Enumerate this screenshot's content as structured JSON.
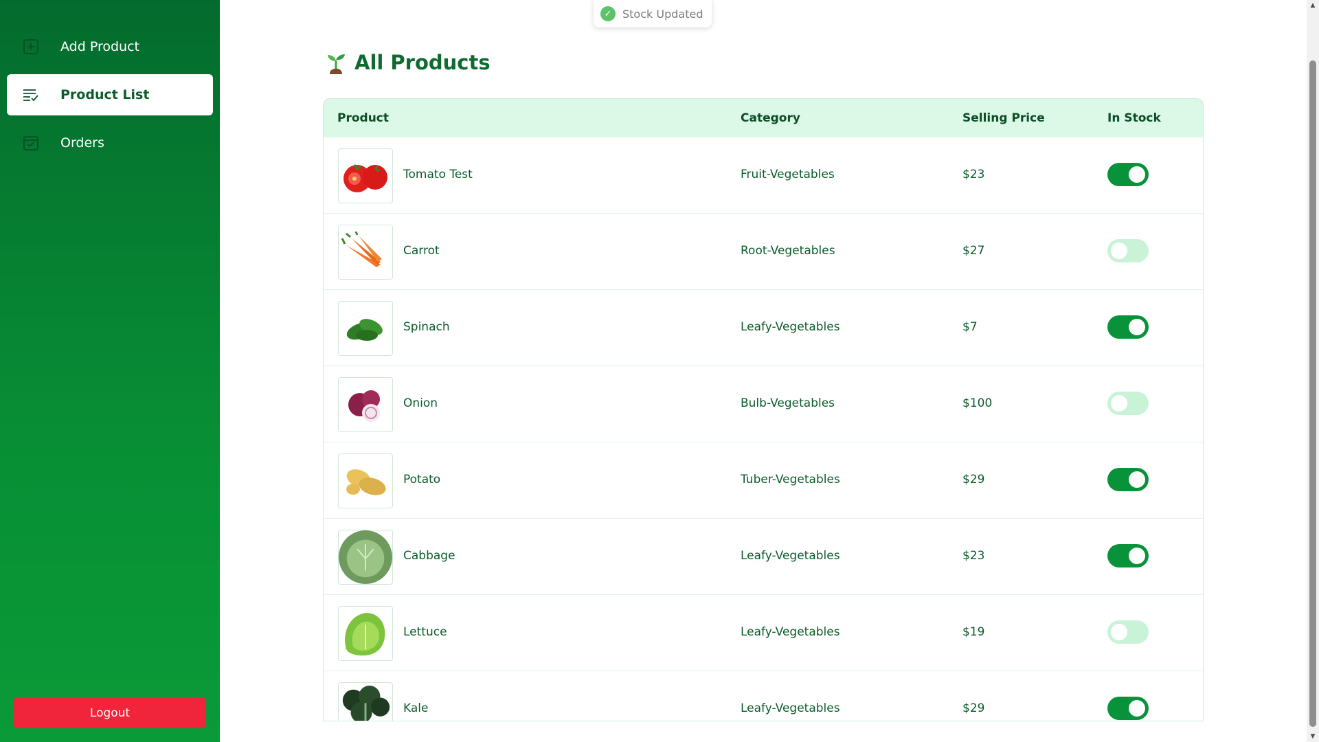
{
  "sidebar": {
    "items": [
      {
        "label": "Add Product",
        "icon": "add-box-icon",
        "active": false
      },
      {
        "label": "Product List",
        "icon": "list-check-icon",
        "active": true
      },
      {
        "label": "Orders",
        "icon": "calendar-check-icon",
        "active": false
      }
    ],
    "logout_label": "Logout"
  },
  "toast": {
    "text": "Stock Updated",
    "icon": "check-circle-icon"
  },
  "page": {
    "title": "All Products",
    "icon": "sprout-icon"
  },
  "table": {
    "headers": {
      "product": "Product",
      "category": "Category",
      "price": "Selling Price",
      "stock": "In Stock"
    },
    "rows": [
      {
        "name": "Tomato Test",
        "category": "Fruit-Vegetables",
        "price": "$23",
        "in_stock": true,
        "image": "tomato-image"
      },
      {
        "name": "Carrot",
        "category": "Root-Vegetables",
        "price": "$27",
        "in_stock": false,
        "image": "carrot-image"
      },
      {
        "name": "Spinach",
        "category": "Leafy-Vegetables",
        "price": "$7",
        "in_stock": true,
        "image": "spinach-image"
      },
      {
        "name": "Onion",
        "category": "Bulb-Vegetables",
        "price": "$100",
        "in_stock": false,
        "image": "onion-image"
      },
      {
        "name": "Potato",
        "category": "Tuber-Vegetables",
        "price": "$29",
        "in_stock": true,
        "image": "potato-image"
      },
      {
        "name": "Cabbage",
        "category": "Leafy-Vegetables",
        "price": "$23",
        "in_stock": true,
        "image": "cabbage-image"
      },
      {
        "name": "Lettuce",
        "category": "Leafy-Vegetables",
        "price": "$19",
        "in_stock": false,
        "image": "lettuce-image"
      },
      {
        "name": "Kale",
        "category": "Leafy-Vegetables",
        "price": "$29",
        "in_stock": true,
        "image": "kale-image"
      }
    ]
  },
  "colors": {
    "primary": "#08933a",
    "sidebar_top": "#046b2e",
    "header_bg": "#dcf8e6",
    "logout": "#f0243a",
    "toggle_off": "#c8f3d6"
  }
}
